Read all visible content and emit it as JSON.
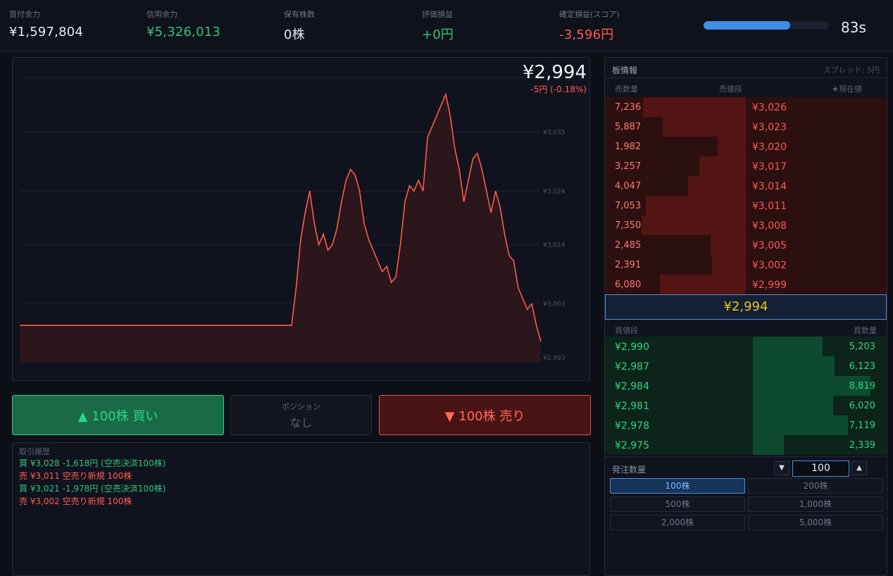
{
  "header": {
    "buying_power": {
      "label": "買付余力",
      "value": "¥1,597,804"
    },
    "margin_power": {
      "label": "信用余力",
      "value": "¥5,326,013"
    },
    "holdings": {
      "label": "保有株数",
      "value": "0株"
    },
    "unrealized": {
      "label": "評価損益",
      "value": "+0円"
    },
    "realized": {
      "label": "確定損益(スコア)",
      "value": "-3,596円"
    },
    "timer": {
      "fraction": 0.69,
      "text": "83s"
    }
  },
  "chart": {
    "price": "¥2,994",
    "change": "-5円 (-0.18%)",
    "line_color": "#ff5a52",
    "y_ticks": [
      "¥3,035",
      "¥3,024",
      "¥3,014",
      "¥3,003",
      "¥2,993"
    ]
  },
  "chart_data": {
    "type": "area",
    "title": "",
    "xlabel": "",
    "ylabel": "",
    "ylim": [
      2992.2,
      3045.4
    ],
    "y_tick_values": [
      3035,
      3024,
      3014,
      3003,
      2993
    ],
    "grid": true,
    "values": [
      2999,
      2999,
      2999,
      2999,
      2999,
      2999,
      2999,
      2999,
      2999,
      2999,
      2999,
      2999,
      2999,
      2999,
      2999,
      2999,
      2999,
      2999,
      2999,
      2999,
      2999,
      2999,
      2999,
      2999,
      2999,
      2999,
      2999,
      2999,
      2999,
      2999,
      2999,
      2999,
      2999,
      2999,
      2999,
      2999,
      2999,
      2999,
      2999,
      2999,
      2999,
      2999,
      2999,
      2999,
      2999,
      2999,
      2999,
      2999,
      2999,
      2999,
      2999,
      2999,
      2999,
      2999,
      2999,
      2999,
      2999,
      2999,
      2999,
      2999,
      2999,
      3006,
      3015,
      3020,
      3024,
      3018,
      3014,
      3016,
      3013,
      3014,
      3017,
      3022,
      3026,
      3028,
      3027,
      3024,
      3018,
      3015,
      3013,
      3011,
      3009,
      3010,
      3007,
      3008,
      3014,
      3022,
      3025,
      3024,
      3026,
      3024,
      3034,
      3036,
      3038,
      3040,
      3042,
      3038,
      3032,
      3028,
      3022,
      3026,
      3030,
      3031,
      3028,
      3024,
      3020,
      3024,
      3021,
      3016,
      3012,
      3011,
      3006,
      3004,
      3002,
      3003,
      2999,
      2996
    ]
  },
  "actions": {
    "buy_label": "▲ 100株 買い",
    "position_label": "ポジション",
    "position_value": "なし",
    "sell_label": "▼ 100株 売り"
  },
  "history": {
    "title": "取引履歴",
    "rows": [
      {
        "text": "買  ¥3,028  -1,618円 (空売決済100株)",
        "side": "buy"
      },
      {
        "text": "売  ¥3,011  空売り新規 100株",
        "side": "sell"
      },
      {
        "text": "買  ¥3,021  -1,978円 (空売決済100株)",
        "side": "buy"
      },
      {
        "text": "売  ¥3,002  空売り新規 100株",
        "side": "sell"
      }
    ]
  },
  "book": {
    "title": "板情報",
    "spread": "スプレッド: 5円",
    "ask_headers": {
      "qty": "売数量",
      "price": "売値段",
      "current": "★現在値"
    },
    "asks": [
      {
        "qty": "7,236",
        "price": "¥3,026",
        "depth": 0.73
      },
      {
        "qty": "5,887",
        "price": "¥3,023",
        "depth": 0.59
      },
      {
        "qty": "1,982",
        "price": "¥3,020",
        "depth": 0.2
      },
      {
        "qty": "3,257",
        "price": "¥3,017",
        "depth": 0.33
      },
      {
        "qty": "4,047",
        "price": "¥3,014",
        "depth": 0.41
      },
      {
        "qty": "7,053",
        "price": "¥3,011",
        "depth": 0.71
      },
      {
        "qty": "7,350",
        "price": "¥3,008",
        "depth": 0.74
      },
      {
        "qty": "2,485",
        "price": "¥3,005",
        "depth": 0.25
      },
      {
        "qty": "2,391",
        "price": "¥3,002",
        "depth": 0.24
      },
      {
        "qty": "6,080",
        "price": "¥2,999",
        "depth": 0.61
      }
    ],
    "current_price": "¥2,994",
    "bid_headers": {
      "price": "買値段",
      "qty": "買数量"
    },
    "bids": [
      {
        "price": "¥2,990",
        "qty": "5,203",
        "depth": 0.52
      },
      {
        "price": "¥2,987",
        "qty": "6,123",
        "depth": 0.61
      },
      {
        "price": "¥2,984",
        "qty": "8,819",
        "depth": 0.88
      },
      {
        "price": "¥2,981",
        "qty": "6,020",
        "depth": 0.6
      },
      {
        "price": "¥2,978",
        "qty": "7,119",
        "depth": 0.71
      },
      {
        "price": "¥2,975",
        "qty": "2,339",
        "depth": 0.23
      }
    ]
  },
  "order": {
    "qty_label": "発注数量",
    "qty_value": "100",
    "down_label": "▼",
    "up_label": "▲",
    "presets": [
      "100株",
      "200株",
      "500株",
      "1,000株",
      "2,000株",
      "5,000株"
    ],
    "selected_index": 0
  }
}
